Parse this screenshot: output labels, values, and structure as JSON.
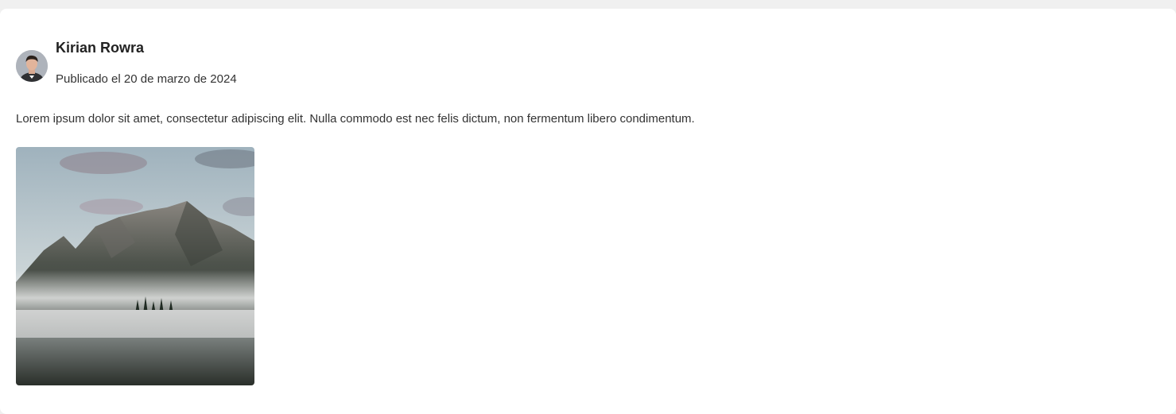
{
  "post": {
    "author_name": "Kirian Rowra",
    "published": "Publicado el 20 de marzo de 2024",
    "body": "Lorem ipsum dolor sit amet, consectetur adipiscing elit. Nulla commodo est nec felis dictum, non fermentum libero condimentum.",
    "avatar_icon": "user-avatar",
    "image_subject": "mountain-lake-fog"
  },
  "colors": {
    "page_bg": "#f0f0f0",
    "card_bg": "#ffffff",
    "text": "#333333"
  }
}
